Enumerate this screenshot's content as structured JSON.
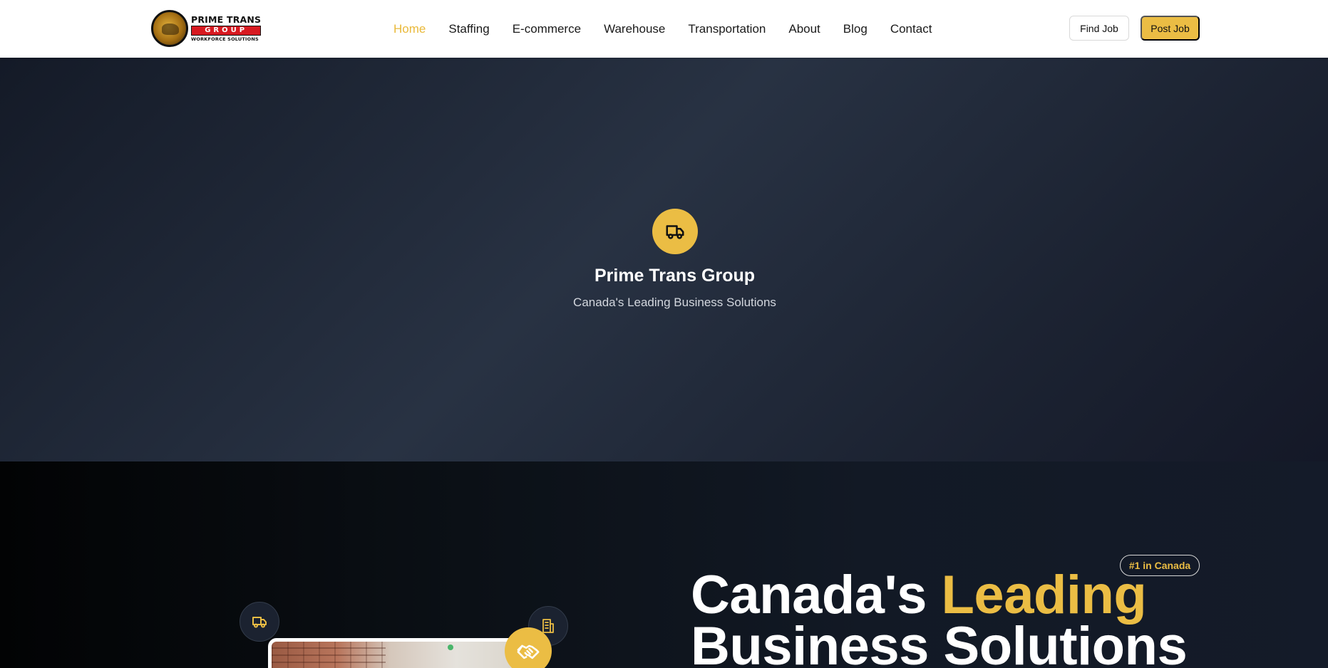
{
  "header": {
    "logo": {
      "line1": "PRIME TRANS",
      "line2": "GROUP",
      "line3": "WORKFORCE SOLUTIONS"
    },
    "nav": [
      {
        "label": "Home",
        "active": true
      },
      {
        "label": "Staffing"
      },
      {
        "label": "E-commerce"
      },
      {
        "label": "Warehouse"
      },
      {
        "label": "Transportation"
      },
      {
        "label": "About"
      },
      {
        "label": "Blog"
      },
      {
        "label": "Contact"
      }
    ],
    "find_job_label": "Find Job",
    "post_job_label": "Post Job"
  },
  "splash": {
    "icon": "truck-icon",
    "title": "Prime Trans Group",
    "subtitle": "Canada's Leading Business Solutions"
  },
  "hero": {
    "badge": "#1 in Canada",
    "title_part1": "Canada's ",
    "title_accent": "Leading",
    "title_line2": "Business Solutions",
    "icons": [
      "truck-icon",
      "building-icon",
      "handshake-icon"
    ]
  },
  "colors": {
    "accent": "#ebbd44",
    "dark": "#141a27",
    "text": "#1a1a1a"
  }
}
